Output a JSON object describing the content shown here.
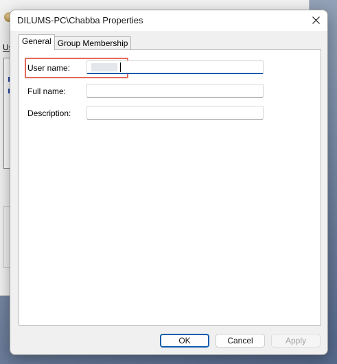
{
  "background_window": {
    "label_fragment": "Us",
    "group_label_fragment": "F"
  },
  "dialog": {
    "title": "DILUMS-PC\\Chabba Properties",
    "close_icon": "close-icon",
    "tabs": [
      {
        "label": "General",
        "active": true
      },
      {
        "label": "Group Membership",
        "active": false
      }
    ],
    "fields": {
      "user_name": {
        "label": "User name:",
        "value": ""
      },
      "full_name": {
        "label": "Full name:",
        "value": ""
      },
      "description": {
        "label": "Description:",
        "value": ""
      }
    },
    "buttons": {
      "ok": "OK",
      "cancel": "Cancel",
      "apply": "Apply"
    }
  },
  "colors": {
    "accent": "#0b5cad",
    "highlight": "#e4685a",
    "dialog_bg": "#f0f0f0",
    "panel_bg": "#ffffff"
  }
}
